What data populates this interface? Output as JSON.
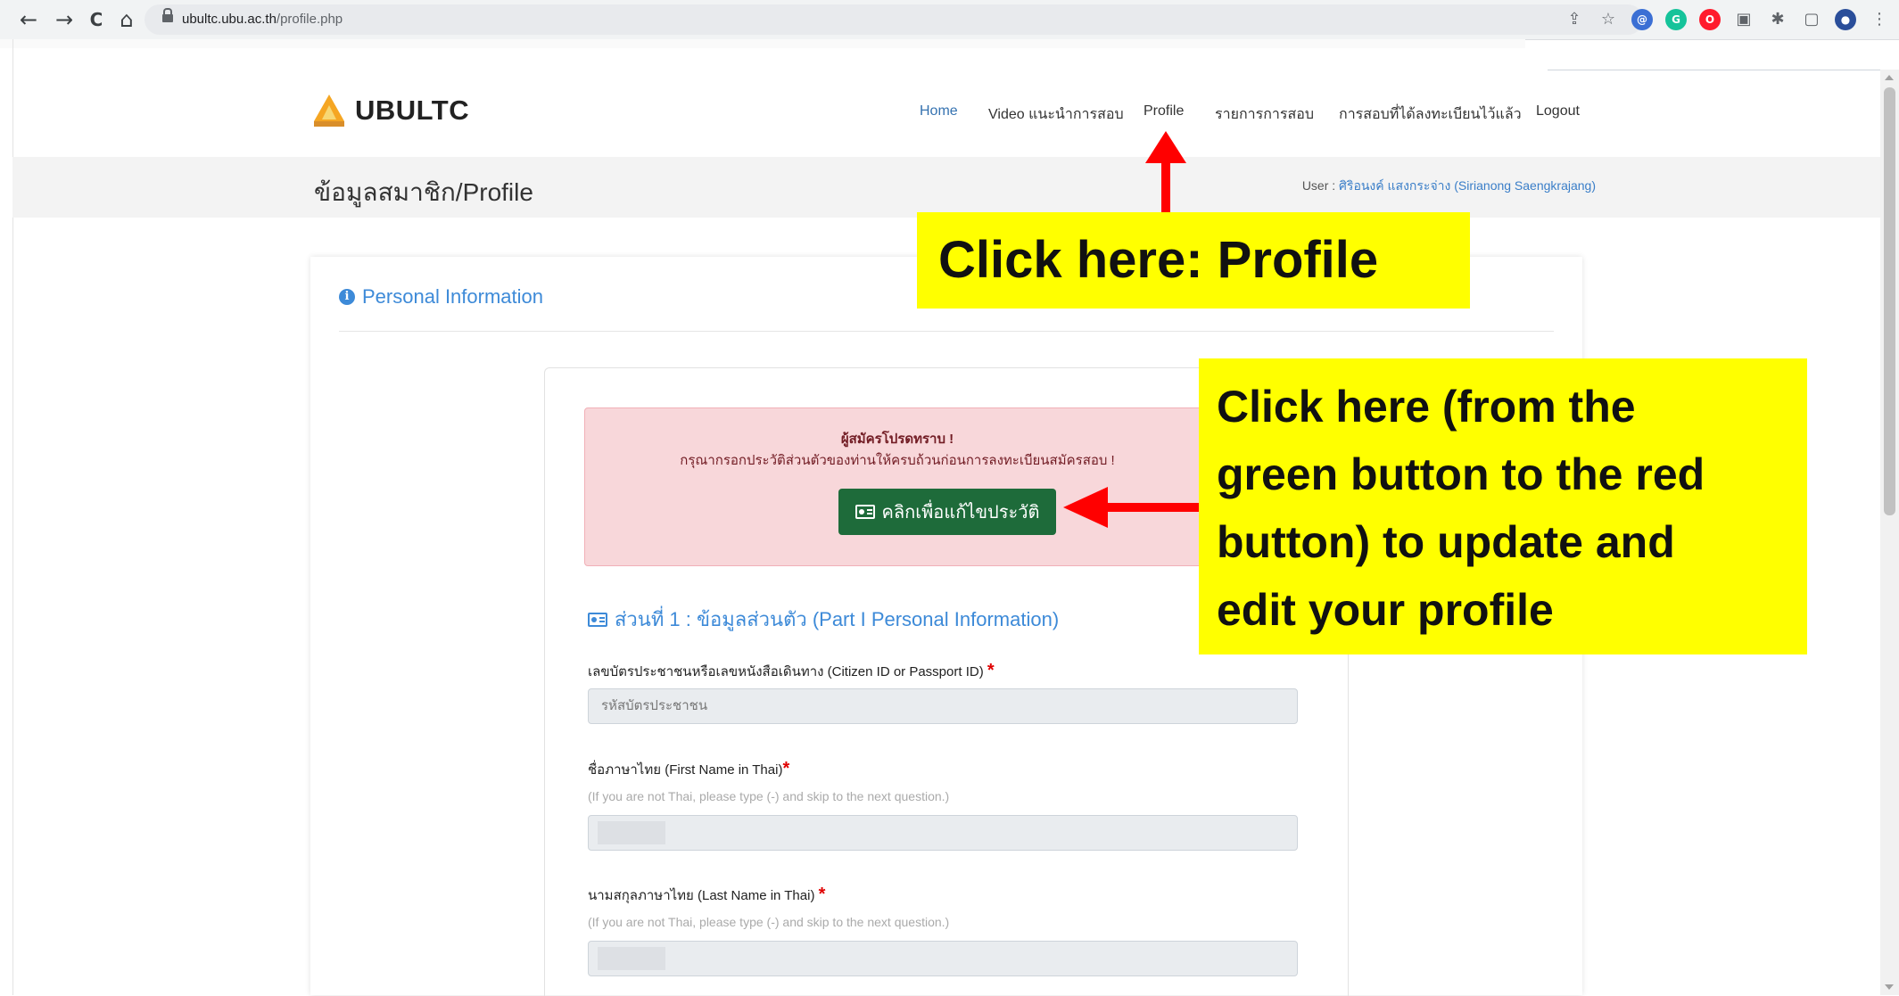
{
  "browser": {
    "url_domain": "ubultc.ubu.ac.th",
    "url_path": "/profile.php",
    "nav": [
      "←",
      "→",
      "C",
      "⌂"
    ],
    "extensions": [
      "share-icon",
      "star-icon",
      "extension-icon",
      "grammarly-icon",
      "opera-icon",
      "screenshot-icon",
      "puzzle-icon",
      "sidepanel-icon",
      "profile-avatar",
      "menu-icon"
    ]
  },
  "site": {
    "logo_text": "UBULTC",
    "nav": {
      "home": "Home",
      "video": "Video แนะนำการสอบ",
      "profile": "Profile",
      "exam_list": "รายการการสอบ",
      "registered": "การสอบที่ได้ลงทะเบียนไว้แล้ว",
      "logout": "Logout"
    },
    "page_title": "ข้อมูลสมาชิก/Profile",
    "user_prefix": "User : ",
    "user_name": "ศิริอนงค์ แสงกระจ่าง (Sirianong Saengkrajang)"
  },
  "card": {
    "heading": "Personal Information",
    "notice_title": "ผู้สมัครโปรดทราบ !",
    "notice_body": "กรุณากรอกประวัติส่วนตัวของท่านให้ครบถ้วนก่อนการลงทะเบียนสมัครสอบ !",
    "edit_button": "คลิกเพื่อแก้ไขประวัติ",
    "section_heading": "ส่วนที่ 1 : ข้อมูลส่วนตัว (Part I Personal Information)",
    "fields": [
      {
        "label": "เลขบัตรประชาชนหรือเลขหนังสือเดินทาง (Citizen ID or Passport ID)",
        "hint": "",
        "value": "รหัสบัตรประชาชน"
      },
      {
        "label": "ชื่อภาษาไทย (First Name in Thai)",
        "hint": "(If you are not Thai, please type (-) and skip to the next question.)",
        "value": ""
      },
      {
        "label": "นามสกุลภาษาไทย (Last Name in Thai)",
        "hint": "(If you are not Thai, please type (-) and skip to the next question.)",
        "value": ""
      }
    ],
    "required_mark": "*"
  },
  "annotations": {
    "profile_callout": "Click here:  Profile",
    "edit_callout_lines": [
      "Click here (from the",
      "green button to the red",
      "button) to update and",
      "edit your profile"
    ],
    "arrow_color": "#ff0000",
    "highlight_color": "#ffff00"
  },
  "colors": {
    "link_blue": "#3572b0",
    "heading_blue": "#3d8ad8",
    "button_green": "#1e6b3a",
    "alert_bg": "#f8d7da"
  }
}
